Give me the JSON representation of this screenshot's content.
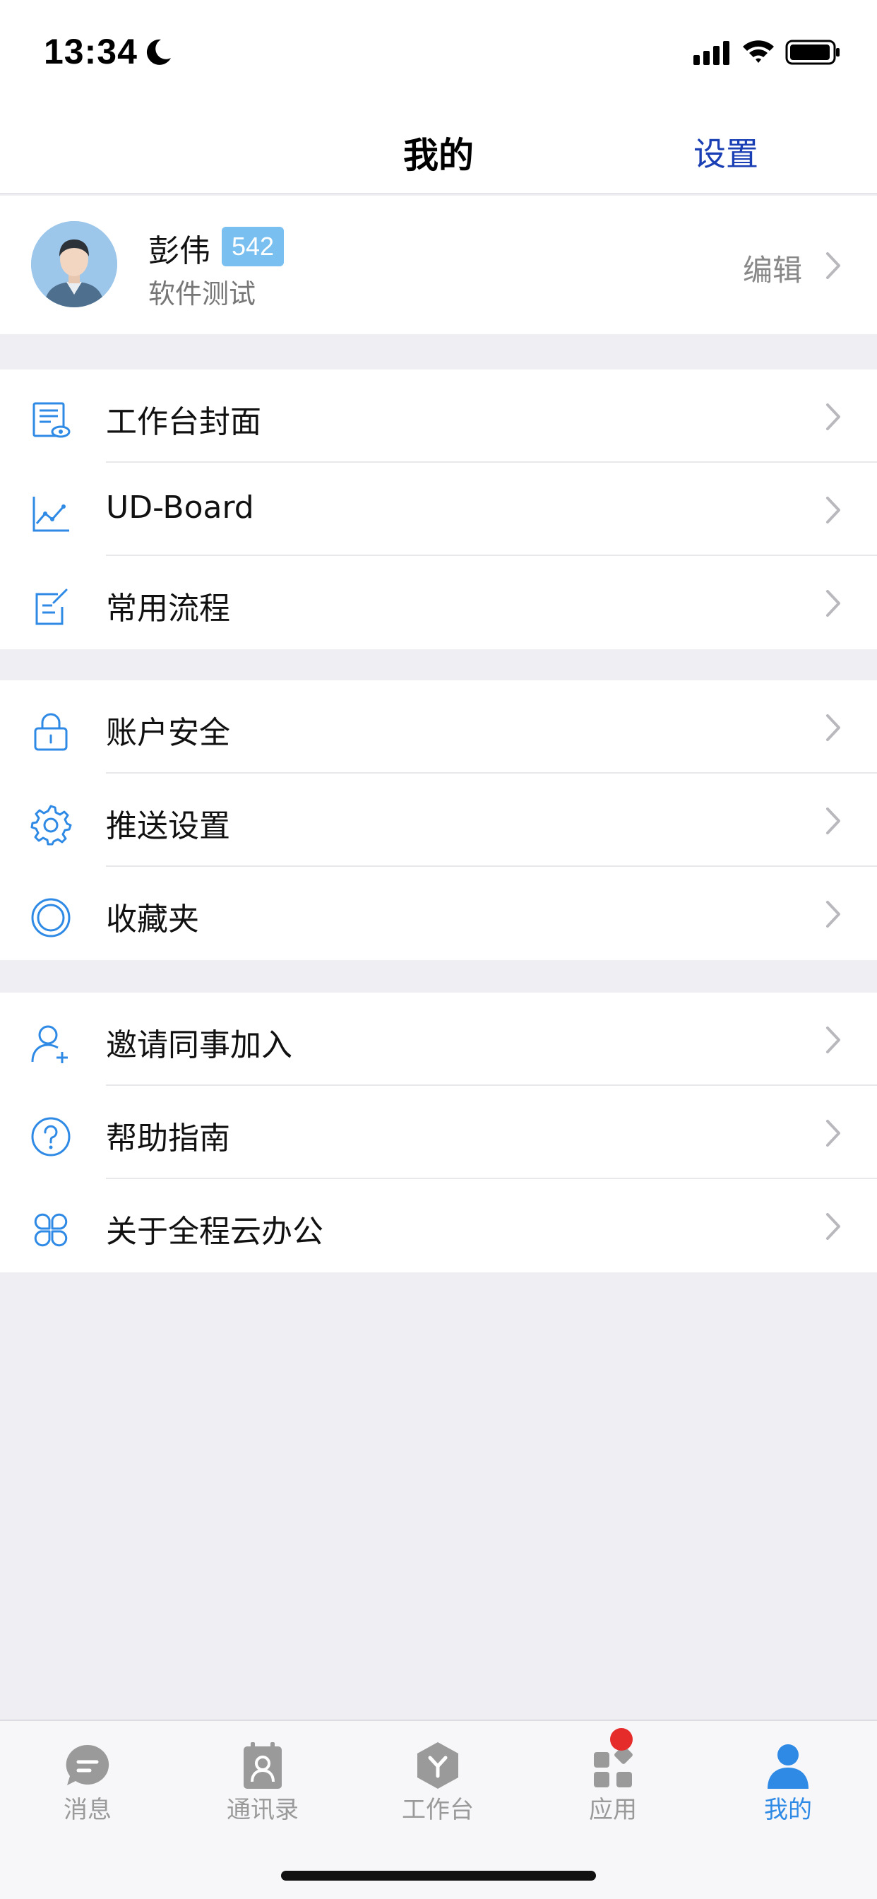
{
  "status_bar": {
    "time": "13:34"
  },
  "nav": {
    "title": "我的",
    "settings_label": "设置"
  },
  "profile": {
    "name": "彭伟",
    "badge": "542",
    "department": "软件测试",
    "edit_label": "编辑"
  },
  "menu_groups": [
    {
      "items": [
        {
          "label": "工作台封面",
          "icon": "workbench-cover-icon"
        },
        {
          "label": "UD-Board",
          "icon": "line-chart-icon"
        },
        {
          "label": "常用流程",
          "icon": "edit-form-icon"
        }
      ]
    },
    {
      "items": [
        {
          "label": "账户安全",
          "icon": "lock-icon"
        },
        {
          "label": "推送设置",
          "icon": "gear-icon"
        },
        {
          "label": "收藏夹",
          "icon": "favorites-ring-icon"
        }
      ]
    },
    {
      "items": [
        {
          "label": "邀请同事加入",
          "icon": "add-user-icon"
        },
        {
          "label": "帮助指南",
          "icon": "help-icon"
        },
        {
          "label": "关于全程云办公",
          "icon": "four-petal-icon"
        }
      ]
    }
  ],
  "tabbar": {
    "tabs": [
      {
        "label": "消息",
        "icon": "message-icon",
        "active": false
      },
      {
        "label": "通讯录",
        "icon": "contacts-icon",
        "active": false
      },
      {
        "label": "工作台",
        "icon": "workbench-icon",
        "active": false
      },
      {
        "label": "应用",
        "icon": "apps-icon",
        "active": false,
        "has_badge_dot": true
      },
      {
        "label": "我的",
        "icon": "profile-icon",
        "active": true
      }
    ]
  },
  "colors": {
    "accent": "#2f8ae5",
    "nav_link": "#1a3fb5",
    "badge_bg": "#79bff0",
    "notification_dot": "#e62b2b",
    "background": "#eeeef3"
  }
}
